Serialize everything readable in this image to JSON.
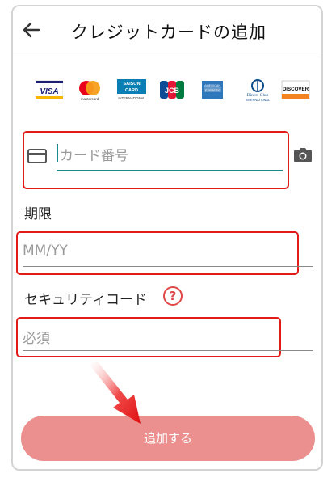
{
  "header": {
    "title": "クレジットカードの追加",
    "back_icon": "arrow-left-icon"
  },
  "brands": [
    {
      "name": "VISA",
      "icon": "visa-logo"
    },
    {
      "name": "mastercard",
      "icon": "mastercard-logo"
    },
    {
      "name": "SAISON CARD INTERNATIONAL",
      "icon": "saison-card-logo"
    },
    {
      "name": "JCB",
      "icon": "jcb-logo"
    },
    {
      "name": "AMERICAN EXPRESS",
      "icon": "amex-logo"
    },
    {
      "name": "Diners Club INTERNATIONAL",
      "icon": "diners-club-logo"
    },
    {
      "name": "DISCOVER",
      "icon": "discover-logo"
    }
  ],
  "card_number": {
    "placeholder": "カード番号",
    "card_icon": "credit-card-icon",
    "camera_icon": "camera-icon"
  },
  "expiry": {
    "label": "期限",
    "placeholder": "MM/YY"
  },
  "security_code": {
    "label": "セキュリティコード",
    "help_icon": "question-circle-icon",
    "help_glyph": "?",
    "placeholder": "必須"
  },
  "submit": {
    "label": "追加する"
  },
  "colors": {
    "accent_teal": "#1a8a8a",
    "highlight_red": "#e21a1a",
    "submit_bg": "#eb8f8f"
  }
}
